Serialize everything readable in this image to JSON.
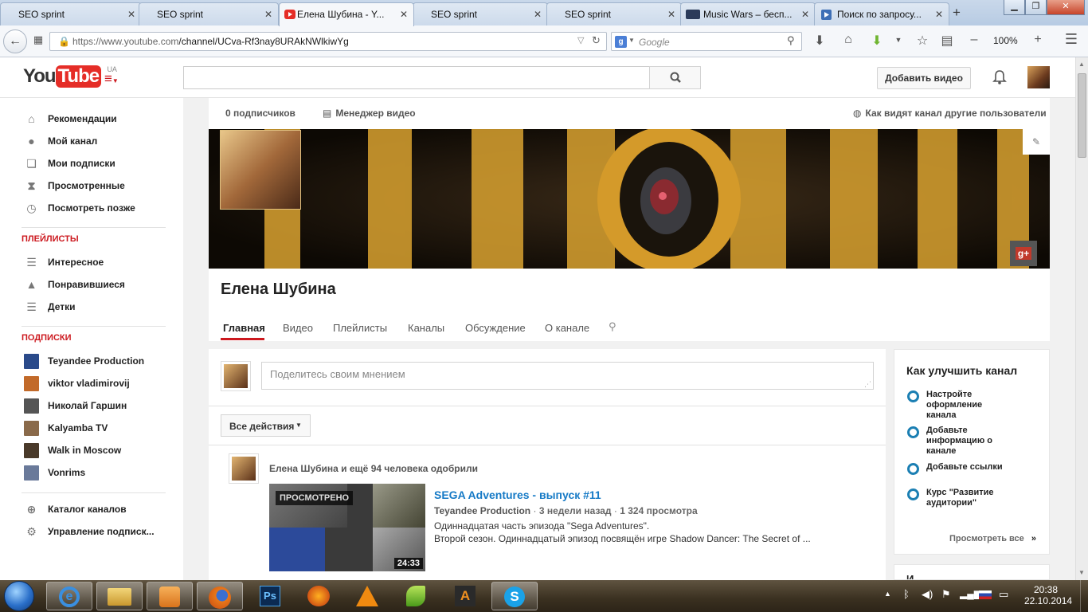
{
  "browser": {
    "tabs": [
      {
        "title": "SEO sprint",
        "icon": "seo-favicon"
      },
      {
        "title": "SEO sprint",
        "icon": "seo-favicon"
      },
      {
        "title": "Елена Шубина - Y...",
        "icon": "youtube-favicon",
        "active": true
      },
      {
        "title": "SEO sprint",
        "icon": "seo-favicon"
      },
      {
        "title": "SEO sprint",
        "icon": "seo-favicon"
      },
      {
        "title": "Music Wars – бесп...",
        "icon": "musicwars-favicon"
      },
      {
        "title": "Поиск по запросу...",
        "icon": "play-favicon"
      }
    ],
    "close_glyph": "✕",
    "new_tab": "+",
    "url_host": "https://www.youtube.com",
    "url_path": "/channel/UCva-Rf3nay8URAkNWlkiwYg",
    "search_engine_placeholder": "Google",
    "zoom": "100%",
    "zoom_minus": "–",
    "zoom_plus": "+"
  },
  "youtube": {
    "logo_you": "You",
    "logo_tube": "Tube",
    "region": "UA",
    "add_video": "Добавить видео"
  },
  "sidebar": {
    "nav": [
      {
        "label": "Рекомендации",
        "icon": "home-icon"
      },
      {
        "label": "Мой канал",
        "icon": "user-icon"
      },
      {
        "label": "Мои подписки",
        "icon": "subscriptions-icon"
      },
      {
        "label": "Просмотренные",
        "icon": "hourglass-icon"
      },
      {
        "label": "Посмотреть позже",
        "icon": "clock-icon"
      }
    ],
    "playlists_header": "ПЛЕЙЛИСТЫ",
    "playlists": [
      {
        "label": "Интересное",
        "icon": "list-icon"
      },
      {
        "label": "Понравившиеся",
        "icon": "thumbs-up-icon"
      },
      {
        "label": "Детки",
        "icon": "list-icon"
      }
    ],
    "subscriptions_header": "ПОДПИСКИ",
    "subscriptions": [
      {
        "label": "Teyandee Production",
        "color": "#2a4a8a"
      },
      {
        "label": "viktor vladimirovij",
        "color": "#c26a2a"
      },
      {
        "label": "Николай Гаршин",
        "color": "#555555"
      },
      {
        "label": "Kalyamba TV",
        "color": "#8a6a4a"
      },
      {
        "label": "Walk in Moscow",
        "color": "#4a3a2a"
      },
      {
        "label": "Vonrims",
        "color": "#6a7a9a"
      }
    ],
    "bottom": [
      {
        "label": "Каталог каналов",
        "icon": "plus-circle-icon"
      },
      {
        "label": "Управление подписк...",
        "icon": "gear-icon"
      }
    ]
  },
  "channel": {
    "subscribers": "0 подписчиков",
    "video_manager": "Менеджер видео",
    "view_as": "Как видят канал другие пользователи",
    "name": "Елена Шубина",
    "tabs": [
      "Главная",
      "Видео",
      "Плейлисты",
      "Каналы",
      "Обсуждение",
      "О канале"
    ],
    "active_tab": 0,
    "gplus": "g+"
  },
  "feed": {
    "share_placeholder": "Поделитесь своим мнением",
    "filter": "Все действия",
    "activity": "Елена Шубина и ещё 94 человека одобрили",
    "video": {
      "title": "SEGA Adventures - выпуск #11",
      "author": "Teyandee Production",
      "age": "3 недели назад",
      "views": "1 324 просмотра",
      "desc1": "Одиннадцатая часть эпизода \"Sega Adventures\".",
      "desc2": "Второй сезон. Одиннадцатый эпизод посвящён игре Shadow Dancer: The Secret of ...",
      "watched": "ПРОСМОТРЕНО",
      "duration": "24:33"
    }
  },
  "improve": {
    "title": "Как улучшить канал",
    "items": [
      "Настройте оформление канала",
      "Добавьте информацию о канале",
      "Добавьте ссылки",
      "Курс \"Развитие аудитории\""
    ],
    "see_all": "Просмотреть все",
    "see_all_arrow": "»",
    "next_peek": "И"
  },
  "taskbar": {
    "time": "20:38",
    "date": "22.10.2014",
    "apps": [
      "start-orb-icon",
      "ie-icon",
      "explorer-icon",
      "media-player-icon",
      "firefox-icon",
      "photoshop-icon",
      "lightning-icon",
      "vlc-icon",
      "corel-icon",
      "aimp-icon",
      "skype-icon"
    ]
  }
}
